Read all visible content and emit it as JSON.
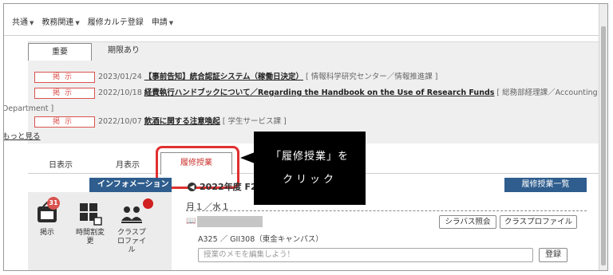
{
  "menu": [
    {
      "label": "共通"
    },
    {
      "label": "教務関連"
    },
    {
      "label": "履修カルテ登録"
    },
    {
      "label": "申請"
    }
  ],
  "notice": {
    "tabs": [
      "重要",
      "期限あり"
    ],
    "items": [
      {
        "badge": "掲示",
        "date": "2023/01/24",
        "title": "【事前告知】統合認証システム（稼働日決定）",
        "source": "[ 情報科学研究センター／情報推進課 ]"
      },
      {
        "badge": "掲示",
        "date": "2022/10/18",
        "title": "経費執行ハンドブックについて／Regarding the Handbook on the Use of Research Funds",
        "source": "[ 総務部経理課／Accounting"
      },
      {
        "badge": "掲示",
        "date": "2022/10/07",
        "title": "飲酒に関する注意喚起",
        "source": "[ 学生サービス課 ]"
      }
    ],
    "source_continued": "Department ]",
    "more": "もっと見る"
  },
  "view_tabs": {
    "day": "日表示",
    "month": "月表示",
    "courses": "履修授業"
  },
  "callout": {
    "line1": "「履修授業」を",
    "line2": "クリック"
  },
  "sidebar": {
    "header": "インフォメーション",
    "items": [
      {
        "label": "掲示",
        "count": "31",
        "icon": "bulletin-icon"
      },
      {
        "label": "時間割変更",
        "icon": "timetable-change-icon"
      },
      {
        "label": "クラスプロファイル",
        "icon": "class-profile-icon"
      }
    ]
  },
  "main": {
    "year": "2022年度 F2",
    "list_button": "履修授業一覧",
    "day": "月１／水１",
    "syllabus_button": "シラバス照会",
    "profile_button": "クラスプロファイル",
    "room": "A325 ／ GII308（東金キャンパス）",
    "memo_placeholder": "授業のメモを編集しよう！",
    "register_button": "登録"
  },
  "colors": {
    "accent_blue": "#2e5d8e",
    "badge_red": "#d9534f",
    "highlight_red": "#e03030"
  }
}
